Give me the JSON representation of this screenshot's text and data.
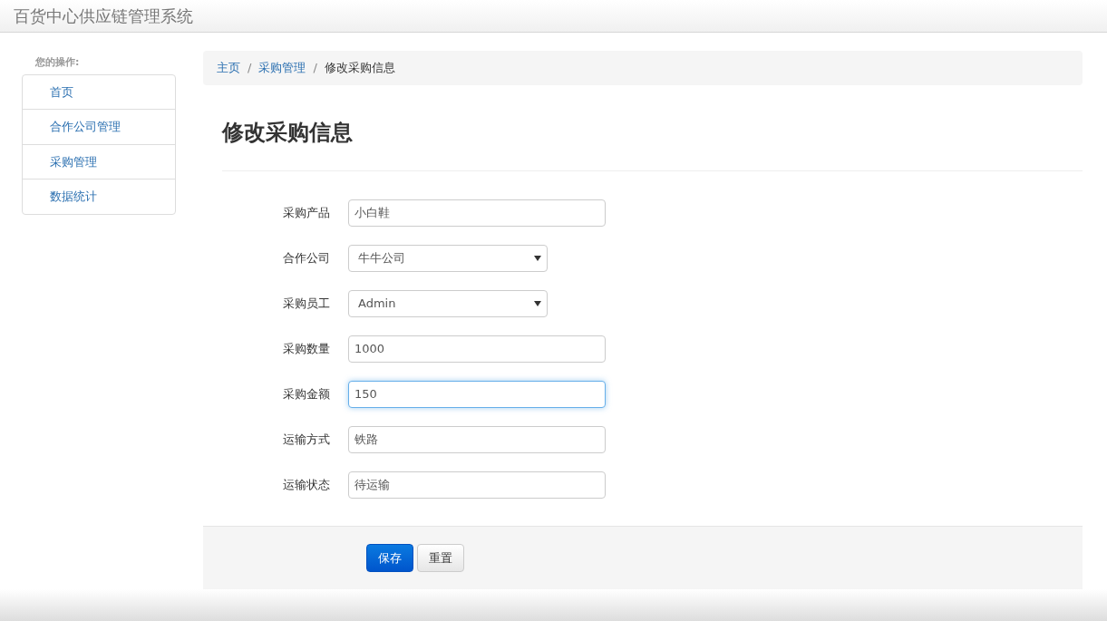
{
  "header": {
    "title": "百货中心供应链管理系统"
  },
  "sidebar": {
    "heading": "您的操作:",
    "items": [
      {
        "label": "首页"
      },
      {
        "label": "合作公司管理"
      },
      {
        "label": "采购管理"
      },
      {
        "label": "数据统计"
      }
    ]
  },
  "breadcrumb": [
    {
      "label": "主页",
      "kind": "link"
    },
    {
      "separator": "/",
      "label": "采购管理",
      "kind": "link"
    },
    {
      "separator": "/",
      "label": "修改采购信息",
      "kind": "current"
    }
  ],
  "page_title": "修改采购信息",
  "form": {
    "fields": [
      {
        "label": "采购产品",
        "kind": "text",
        "value": "小白鞋",
        "focused": false
      },
      {
        "label": "合作公司",
        "kind": "select",
        "value": "牛牛公司",
        "focused": false
      },
      {
        "label": "采购员工",
        "kind": "select",
        "value": "Admin",
        "focused": false
      },
      {
        "label": "采购数量",
        "kind": "text",
        "value": "1000",
        "focused": false
      },
      {
        "label": "采购金额",
        "kind": "text",
        "value": "150",
        "focused": true
      },
      {
        "label": "运输方式",
        "kind": "text",
        "value": "铁路",
        "focused": false
      },
      {
        "label": "运输状态",
        "kind": "text",
        "value": "待运输",
        "focused": false
      }
    ],
    "buttons": [
      {
        "label": "保存",
        "kind": "primary"
      },
      {
        "label": "重置",
        "kind": "default"
      }
    ]
  }
}
